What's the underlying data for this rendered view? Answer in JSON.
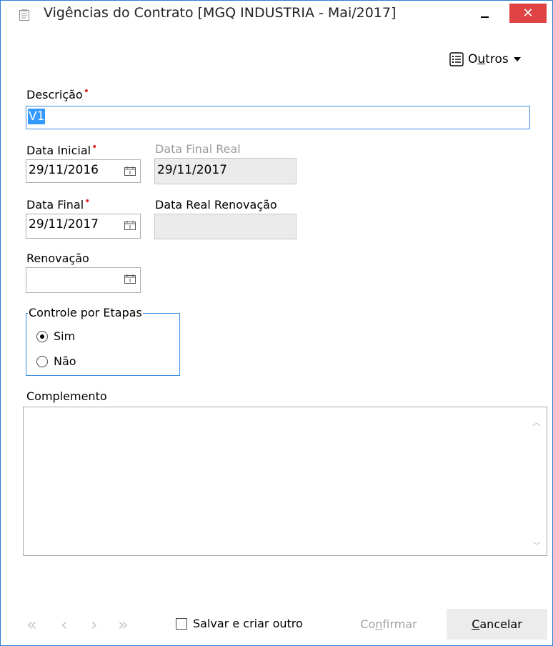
{
  "window": {
    "title": "Vigências do Contrato [MGQ INDUSTRIA - Mai/2017]",
    "close_label": "✕",
    "accent": "#2a7fd4",
    "close_color": "#e04343"
  },
  "toolbar": {
    "outros_pre": "O",
    "outros_u": "u",
    "outros_post": "tros"
  },
  "fields": {
    "descricao": {
      "label": "Descrição",
      "value": "V1"
    },
    "data_inicial": {
      "label": "Data Inicial",
      "value": "29/11/2016"
    },
    "data_final_real": {
      "label": "Data Final Real",
      "value": "29/11/2017"
    },
    "data_final": {
      "label": "Data Final",
      "value": "29/11/2017"
    },
    "data_real_renovacao": {
      "label": "Data Real Renovação",
      "value": ""
    },
    "renovacao": {
      "label": "Renovação",
      "value": ""
    }
  },
  "controle": {
    "title": "Controle por Etapas",
    "options": [
      {
        "label": "Sim",
        "selected": true
      },
      {
        "label": "Não",
        "selected": false
      }
    ]
  },
  "complemento": {
    "label": "Complemento",
    "value": ""
  },
  "footer": {
    "nav": [
      "«",
      "‹",
      "›",
      "»"
    ],
    "save_and_new": "Salvar e criar outro",
    "confirm_pre": "Co",
    "confirm_u": "n",
    "confirm_post": "firmar",
    "cancel_u": "C",
    "cancel_post": "ancelar"
  }
}
